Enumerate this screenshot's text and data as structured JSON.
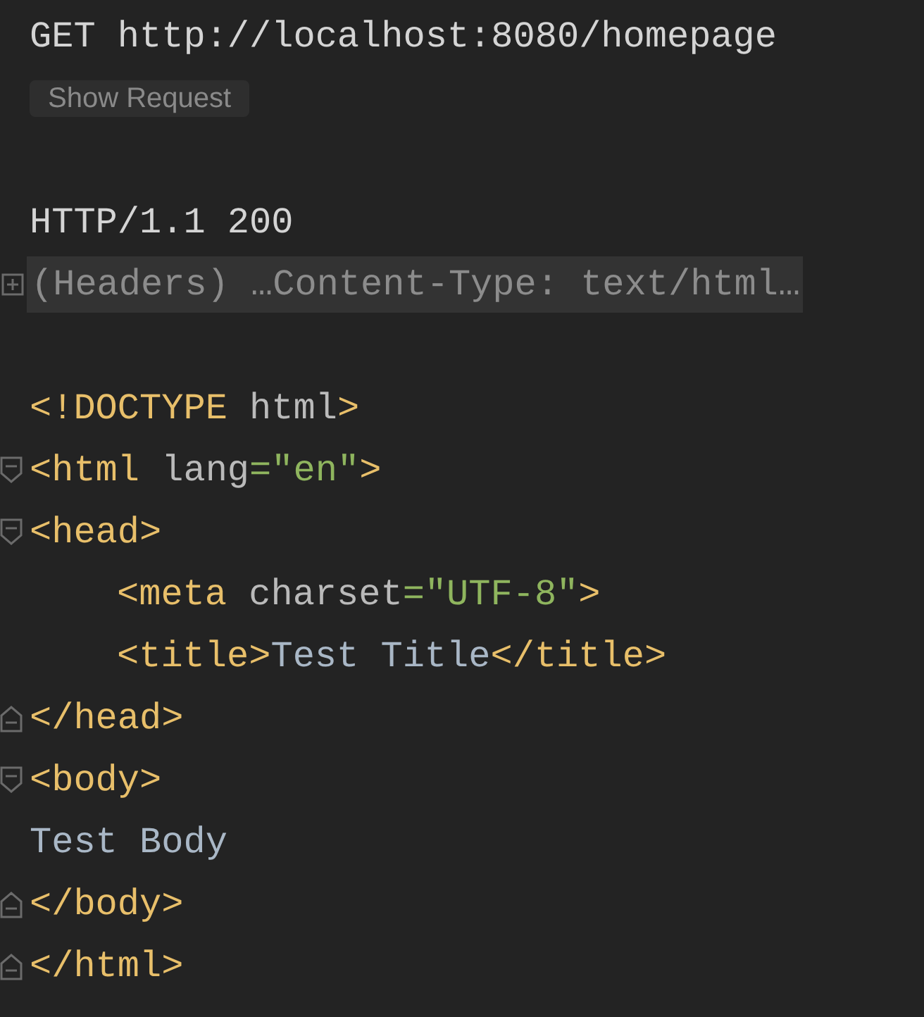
{
  "request": {
    "line": "GET http://localhost:8080/homepage",
    "button": "Show Request"
  },
  "status_line": "HTTP/1.1 200",
  "headers": {
    "text": "(Headers) …Content-Type: text/html…",
    "expanded": false
  },
  "body": [
    {
      "kind": "plain",
      "tokens": [
        {
          "kind": "tag",
          "text": "<!DOCTYPE "
        },
        {
          "kind": "attr",
          "text": "html"
        },
        {
          "kind": "tag",
          "text": ">"
        }
      ]
    },
    {
      "kind": "opening",
      "tokens": [
        {
          "kind": "tag",
          "text": "<html "
        },
        {
          "kind": "attr",
          "text": "lang"
        },
        {
          "kind": "value",
          "text": "=\"en\""
        },
        {
          "kind": "tag",
          "text": ">"
        }
      ]
    },
    {
      "kind": "opening",
      "tokens": [
        {
          "kind": "tag",
          "text": "<head>"
        }
      ],
      "children": [
        {
          "kind": "plain",
          "tokens": [
            {
              "kind": "tag",
              "text": "<meta "
            },
            {
              "kind": "attr",
              "text": "charset"
            },
            {
              "kind": "value",
              "text": "=\"UTF-8\""
            },
            {
              "kind": "tag",
              "text": ">"
            }
          ]
        },
        {
          "kind": "plain",
          "tokens": [
            {
              "kind": "tag",
              "text": "<title>"
            },
            {
              "kind": "text",
              "text": "Test Title"
            },
            {
              "kind": "tag",
              "text": "</title>"
            }
          ]
        }
      ]
    },
    {
      "kind": "closing",
      "tokens": [
        {
          "kind": "tag",
          "text": "</head>"
        }
      ]
    },
    {
      "kind": "opening",
      "tokens": [
        {
          "kind": "tag",
          "text": "<body>"
        }
      ]
    },
    {
      "kind": "plain",
      "tokens": [
        {
          "kind": "text",
          "text": "Test Body"
        }
      ]
    },
    {
      "kind": "closing",
      "tokens": [
        {
          "kind": "tag",
          "text": "</body>"
        }
      ]
    },
    {
      "kind": "closing",
      "tokens": [
        {
          "kind": "tag",
          "text": "</html>"
        }
      ]
    }
  ]
}
